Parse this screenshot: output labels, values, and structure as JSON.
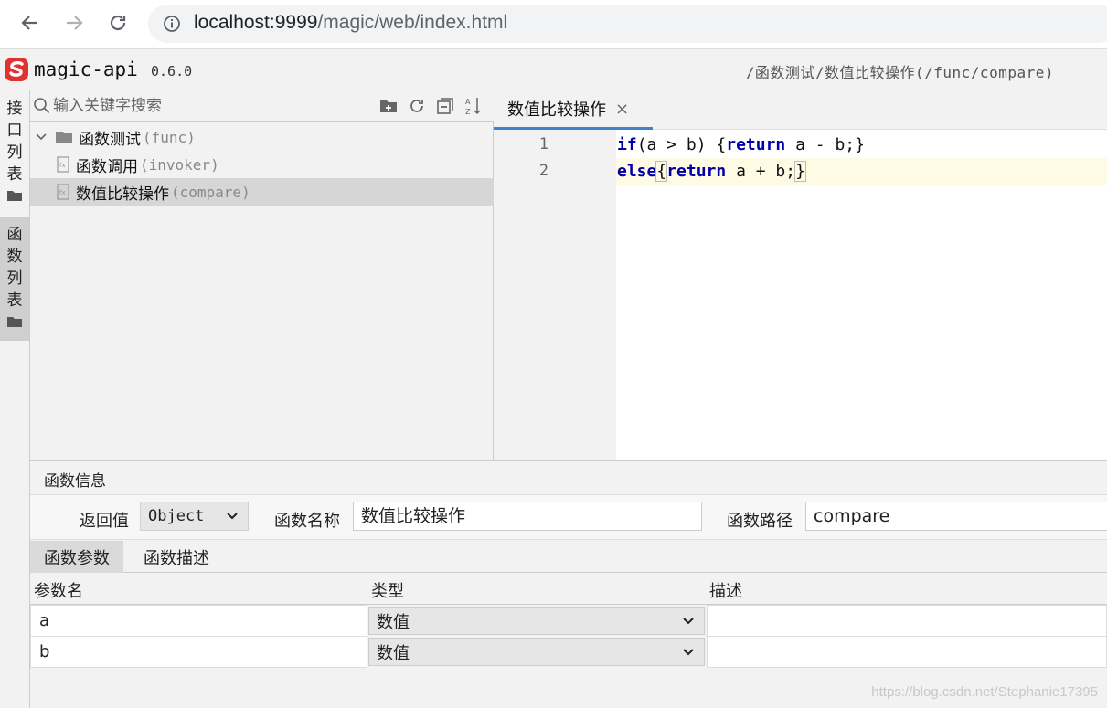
{
  "browser": {
    "url_host": "localhost:9999",
    "url_path": "/magic/web/index.html"
  },
  "header": {
    "app_name": "magic-api",
    "version": "0.6.0",
    "path": "/函数测试/数值比较操作(/func/compare)"
  },
  "sidebar": {
    "tabs": [
      {
        "label": [
          "接",
          "口",
          "列",
          "表"
        ]
      },
      {
        "label": [
          "函",
          "数",
          "列",
          "表"
        ]
      }
    ]
  },
  "tree": {
    "search_placeholder": "输入关键字搜索",
    "items": [
      {
        "label": "函数测试",
        "sub": "(func)"
      },
      {
        "label": "函数调用",
        "sub": "(invoker)"
      },
      {
        "label": "数值比较操作",
        "sub": "(compare)"
      }
    ]
  },
  "editor": {
    "tab_label": "数值比较操作",
    "lines": [
      "1",
      "2"
    ]
  },
  "info": {
    "title": "函数信息",
    "return_label": "返回值",
    "return_value": "Object",
    "name_label": "函数名称",
    "name_value": "数值比较操作",
    "path_label": "函数路径",
    "path_value": "compare"
  },
  "params": {
    "tabs": [
      "函数参数",
      "函数描述"
    ],
    "headers": [
      "参数名",
      "类型",
      "描述"
    ],
    "rows": [
      {
        "name": "a",
        "type": "数值",
        "desc": ""
      },
      {
        "name": "b",
        "type": "数值",
        "desc": ""
      }
    ]
  },
  "watermark": "https://blog.csdn.net/Stephanie17395",
  "colors": {
    "accent": "#4083c9",
    "keyword": "#0000aa",
    "logo": "#e0322f"
  }
}
